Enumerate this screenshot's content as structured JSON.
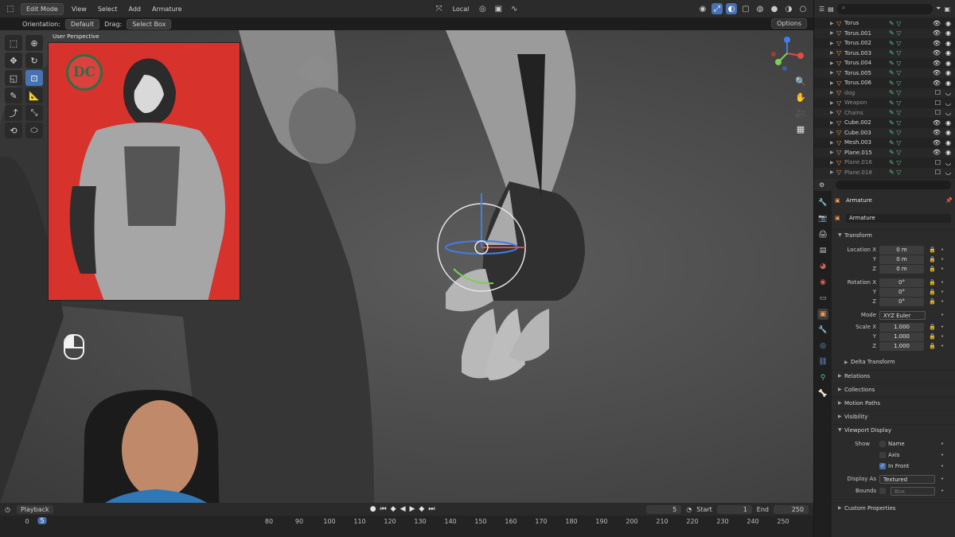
{
  "header": {
    "mode": "Edit Mode",
    "menus": [
      "View",
      "Select",
      "Add",
      "Armature"
    ],
    "pivot": "Local"
  },
  "tool_settings": {
    "orientation_label": "Orientation:",
    "orientation_value": "Default",
    "drag_label": "Drag:",
    "drag_value": "Select Box",
    "options_label": "Options"
  },
  "viewport": {
    "label": "User Perspective",
    "reference_logo_text": "DC"
  },
  "outliner": {
    "items": [
      {
        "name": "Torus",
        "dim": false
      },
      {
        "name": "Torus.001",
        "dim": false
      },
      {
        "name": "Torus.002",
        "dim": false
      },
      {
        "name": "Torus.003",
        "dim": false
      },
      {
        "name": "Torus.004",
        "dim": false
      },
      {
        "name": "Torus.005",
        "dim": false
      },
      {
        "name": "Torus.006",
        "dim": false
      },
      {
        "name": "dog",
        "dim": true
      },
      {
        "name": "Weapon",
        "dim": true
      },
      {
        "name": "Chains",
        "dim": true
      },
      {
        "name": "Cube.002",
        "dim": false
      },
      {
        "name": "Cube.003",
        "dim": false
      },
      {
        "name": "Mesh.003",
        "dim": false
      },
      {
        "name": "Plane.015",
        "dim": false
      },
      {
        "name": "Plane.016",
        "dim": true
      },
      {
        "name": "Plane.018",
        "dim": true
      }
    ]
  },
  "properties": {
    "object_name": "Armature",
    "data_name": "Armature",
    "transform_label": "Transform",
    "location_x_label": "Location X",
    "location_x": "0 m",
    "location_y": "0 m",
    "location_z": "0 m",
    "rotation_x_label": "Rotation X",
    "rotation_x": "0°",
    "rotation_y": "0°",
    "rotation_z": "0°",
    "mode_label": "Mode",
    "mode_value": "XYZ Euler",
    "scale_x_label": "Scale X",
    "scale_x": "1.000",
    "scale_y": "1.000",
    "scale_z": "1.000",
    "y_label": "Y",
    "z_label": "Z",
    "delta_transform": "Delta Transform",
    "relations": "Relations",
    "collections": "Collections",
    "motion_paths": "Motion Paths",
    "visibility": "Visibility",
    "viewport_display": "Viewport Display",
    "show_label": "Show",
    "name_label": "Name",
    "axis_label": "Axis",
    "in_front_label": "In Front",
    "display_as_label": "Display As",
    "display_as_value": "Textured",
    "bounds_label": "Bounds",
    "bounds_value": "Box",
    "custom_properties": "Custom Properties"
  },
  "timeline": {
    "playback_label": "Playback",
    "current_frame": "5",
    "start_label": "Start",
    "start_value": "1",
    "end_label": "End",
    "end_value": "250",
    "ticks": [
      "0",
      "80",
      "90",
      "100",
      "110",
      "120",
      "130",
      "140",
      "150",
      "160",
      "170",
      "180",
      "190",
      "200",
      "210",
      "220",
      "230",
      "240",
      "250"
    ],
    "playhead": "5"
  },
  "colors": {
    "accent": "#4772b3",
    "reference_bg": "#d8322d",
    "logo_green": "#2e6e47",
    "object_orange": "#f39a4d",
    "modifier_green": "#5ec08a"
  }
}
